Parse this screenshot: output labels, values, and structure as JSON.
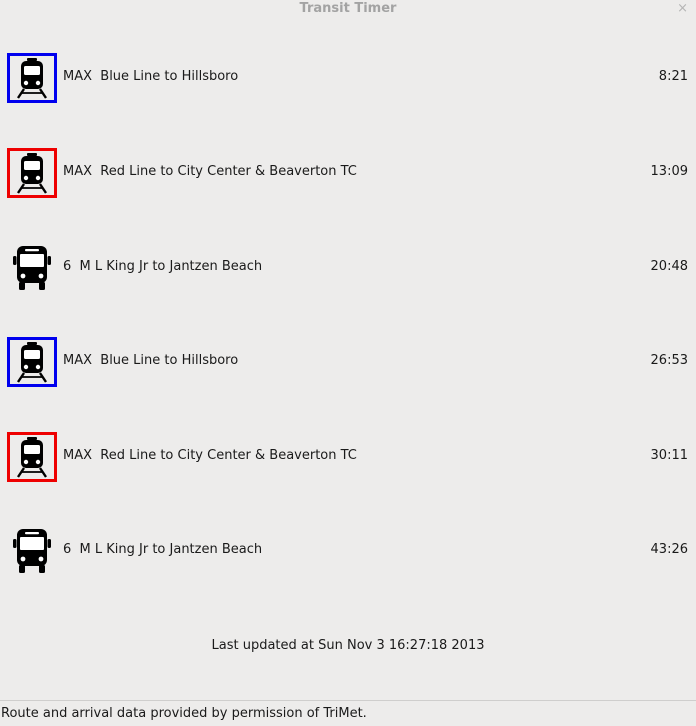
{
  "window": {
    "title": "Transit Timer",
    "close_glyph": "×"
  },
  "arrivals": [
    {
      "icon": "light-rail-icon",
      "line_color": "#0000ee",
      "route": "MAX  Blue Line to Hillsboro",
      "time": "8:21"
    },
    {
      "icon": "light-rail-icon",
      "line_color": "#ee0000",
      "route": "MAX  Red Line to City Center & Beaverton TC",
      "time": "13:09"
    },
    {
      "icon": "bus-icon",
      "line_color": null,
      "route": "6  M L King Jr to Jantzen Beach",
      "time": "20:48"
    },
    {
      "icon": "light-rail-icon",
      "line_color": "#0000ee",
      "route": "MAX  Blue Line to Hillsboro",
      "time": "26:53"
    },
    {
      "icon": "light-rail-icon",
      "line_color": "#ee0000",
      "route": "MAX  Red Line to City Center & Beaverton TC",
      "time": "30:11"
    },
    {
      "icon": "bus-icon",
      "line_color": null,
      "route": "6  M L King Jr to Jantzen Beach",
      "time": "43:26"
    }
  ],
  "status": {
    "last_updated": "Last updated at Sun Nov 3 16:27:18 2013",
    "attribution": "Route and arrival data provided by permission of TriMet."
  }
}
